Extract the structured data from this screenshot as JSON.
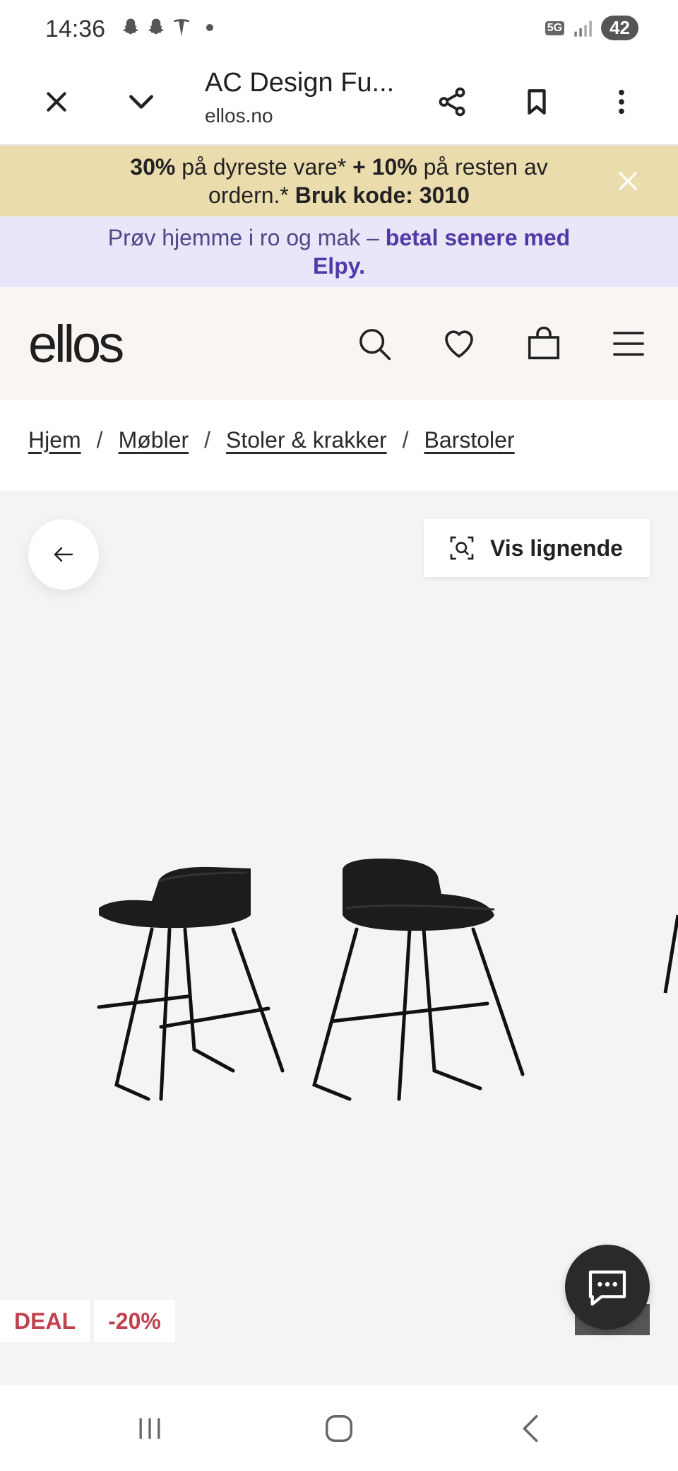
{
  "status_bar": {
    "time": "14:36",
    "network": "5G",
    "battery": "42"
  },
  "browser": {
    "title": "AC Design Fu...",
    "domain": "ellos.no",
    "icons": [
      "close-icon",
      "chevron-down-icon",
      "share-icon",
      "bookmark-icon",
      "more-vert-icon"
    ]
  },
  "promo": {
    "part1_bold": "30%",
    "part2": " på dyreste vare* ",
    "part3_bold": "+ 10%",
    "part4": " på resten av ordern.* ",
    "part5_bold": "Bruk kode: 3010"
  },
  "elpy": {
    "text": "Prøv hjemme i ro og mak – ",
    "link": "betal senere med Elpy."
  },
  "header": {
    "logo": "ellos",
    "icons": [
      "search-icon",
      "heart-icon",
      "bag-icon",
      "menu-icon"
    ]
  },
  "breadcrumb": {
    "items": [
      "Hjem",
      "Møbler",
      "Stoler & krakker",
      "Barstoler"
    ],
    "separator": "/"
  },
  "product": {
    "similar_label": "Vis lignende",
    "badges": [
      "DEAL",
      "-20%"
    ]
  },
  "colors": {
    "promo_bg": "#ebdcae",
    "elpy_bg": "#e8e6f8",
    "elpy_accent": "#5239a8",
    "badge_text": "#c0404e",
    "header_bg": "#f8f5f2"
  }
}
